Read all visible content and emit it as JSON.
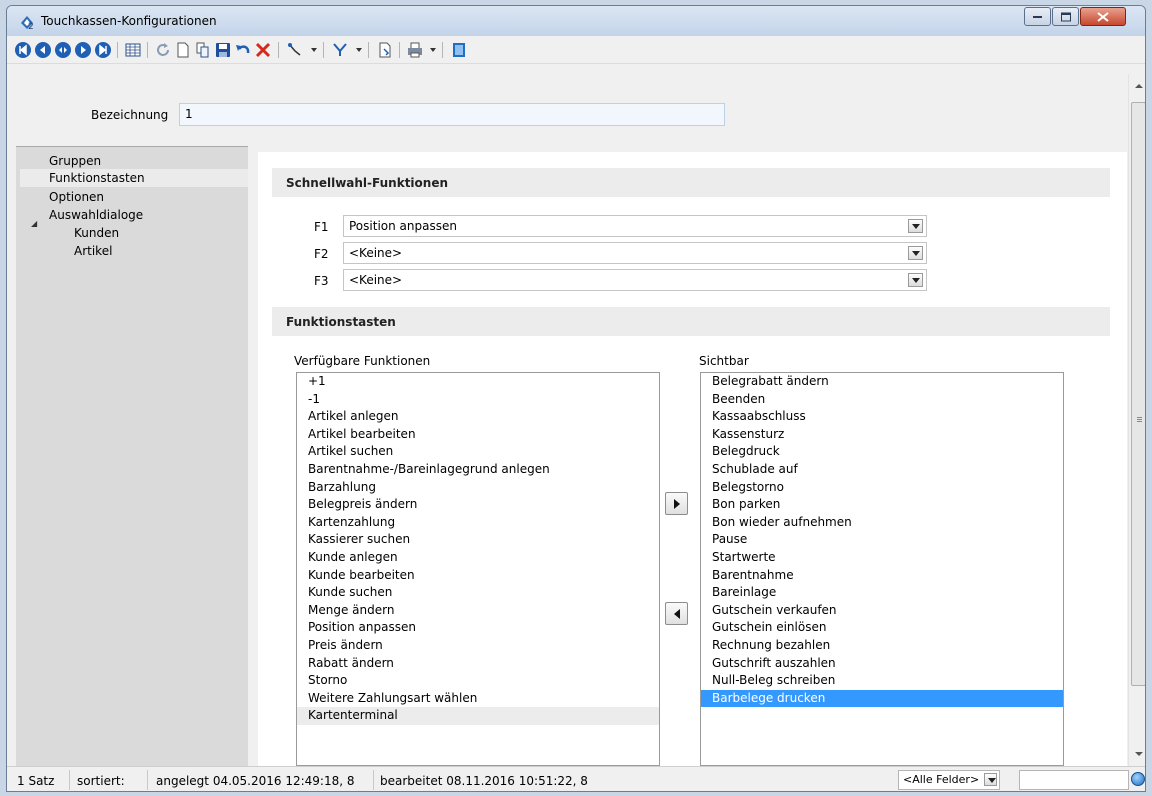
{
  "window": {
    "title": "Touchkassen-Konfigurationen"
  },
  "form": {
    "bezeichnung_label": "Bezeichnung",
    "bezeichnung_value": "1"
  },
  "sidebar": {
    "items": [
      {
        "label": "Gruppen"
      },
      {
        "label": "Funktionstasten"
      },
      {
        "label": "Optionen"
      },
      {
        "label": "Auswahldialoge"
      },
      {
        "label": "Kunden"
      },
      {
        "label": "Artikel"
      }
    ]
  },
  "schnellwahl": {
    "heading": "Schnellwahl-Funktionen",
    "rows": [
      {
        "key": "F1",
        "value": "Position anpassen"
      },
      {
        "key": "F2",
        "value": "<Keine>"
      },
      {
        "key": "F3",
        "value": "<Keine>"
      }
    ]
  },
  "funktionstasten": {
    "heading": "Funktionstasten",
    "available_label": "Verfügbare Funktionen",
    "visible_label": "Sichtbar",
    "available": [
      "+1",
      "-1",
      "Artikel anlegen",
      "Artikel bearbeiten",
      "Artikel suchen",
      "Barentnahme-/Bareinlagegrund anlegen",
      "Barzahlung",
      "Belegpreis ändern",
      "Kartenzahlung",
      "Kassierer suchen",
      "Kunde anlegen",
      "Kunde bearbeiten",
      "Kunde suchen",
      "Menge ändern",
      "Position anpassen",
      "Preis ändern",
      "Rabatt ändern",
      "Storno",
      "Weitere Zahlungsart wählen",
      "Kartenterminal"
    ],
    "visible": [
      "Belegrabatt ändern",
      "Beenden",
      "Kassaabschluss",
      "Kassensturz",
      "Belegdruck",
      "Schublade auf",
      "Belegstorno",
      "Bon parken",
      "Bon wieder aufnehmen",
      "Pause",
      "Startwerte",
      "Barentnahme",
      "Bareinlage",
      "Gutschein verkaufen",
      "Gutschein einlösen",
      "Rechnung bezahlen",
      "Gutschrift auszahlen",
      "Null-Beleg schreiben",
      "Barbelege drucken"
    ],
    "selected_visible": "Barbelege drucken",
    "hover_available": "Kartenterminal"
  },
  "statusbar": {
    "count": "1 Satz",
    "sorted": "sortiert:",
    "created": "angelegt 04.05.2016 12:49:18,  8",
    "edited": "bearbeitet 08.11.2016 10:51:22,  8",
    "field_select": "<Alle Felder>"
  },
  "colors": {
    "selection": "#3399ff",
    "sidebar_bg": "#dadada",
    "section_bg": "#ececec"
  }
}
